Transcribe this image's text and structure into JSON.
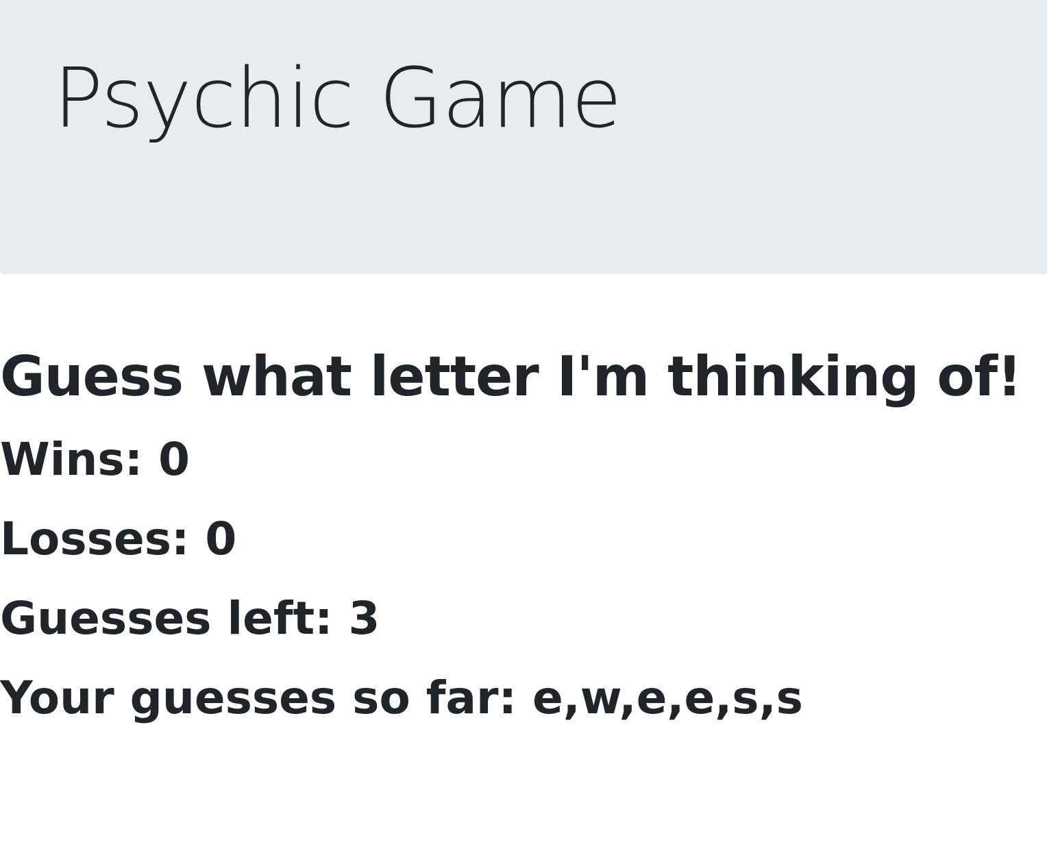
{
  "header": {
    "title": "Psychic Game"
  },
  "game": {
    "prompt": "Guess what letter I'm thinking of!",
    "wins_text": "Wins: 0",
    "losses_text": "Losses: 0",
    "guesses_left_text": "Guesses left: 3",
    "guesses_so_far_text": "Your guesses so far: e,w,e,e,s,s"
  },
  "colors": {
    "header_background": "#e9ecef",
    "text": "#212529",
    "page_background": "#ffffff"
  }
}
